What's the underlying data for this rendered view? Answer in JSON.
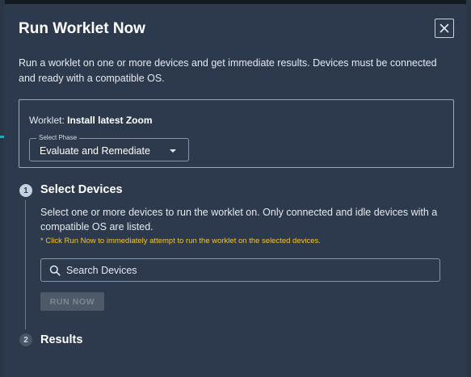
{
  "dialog": {
    "title": "Run Worklet Now",
    "close_icon": "close-icon",
    "description": "Run a worklet on one or more devices and get immediate results. Devices must be connected and ready with a compatible OS."
  },
  "worklet": {
    "label": "Worklet:",
    "name": "Install latest Zoom",
    "phase_select": {
      "label": "Select Phase",
      "value": "Evaluate and Remediate"
    }
  },
  "steps": [
    {
      "number": "1",
      "title": "Select Devices",
      "description": "Select one or more devices to run the worklet on. Only connected and idle devices with a compatible OS are listed.",
      "note": "* Click Run Now to immediately attempt to run the worklet on the selected devices.",
      "search": {
        "placeholder": "Search Devices",
        "value": ""
      },
      "run_button": "RUN NOW",
      "run_button_disabled": true
    },
    {
      "number": "2",
      "title": "Results"
    }
  ],
  "colors": {
    "modal_bg": "#2d3a4d",
    "accent_border": "#5cc7d0",
    "note": "#f3c432"
  }
}
